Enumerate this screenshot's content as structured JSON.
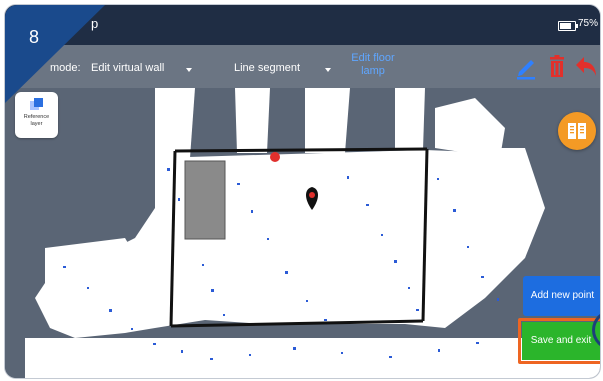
{
  "status_bar": {
    "title": "p",
    "battery": "75%",
    "battery_level": 0.75
  },
  "step_badge": {
    "number": "8"
  },
  "toolbar": {
    "mode_label": "mode:",
    "mode_value": "Edit virtual wall",
    "tool_value": "Line segment",
    "edit_floor_line1": "Edit floor",
    "edit_floor_line2": "lamp",
    "icons": [
      "pencil-icon",
      "trash-icon",
      "undo-icon"
    ]
  },
  "reference_layer": {
    "label_line1": "Reference",
    "label_line2": "layer"
  },
  "buttons": {
    "add_new_point": "Add new point",
    "save_and_exit": "Save and exit"
  },
  "colors": {
    "accent_blue": "#1d6de0",
    "save_green": "#2bb52b",
    "highlight_orange": "#ee6522",
    "delete_red": "#e2302b",
    "book_orange": "#f49a25",
    "marker_red": "#e0302d"
  }
}
